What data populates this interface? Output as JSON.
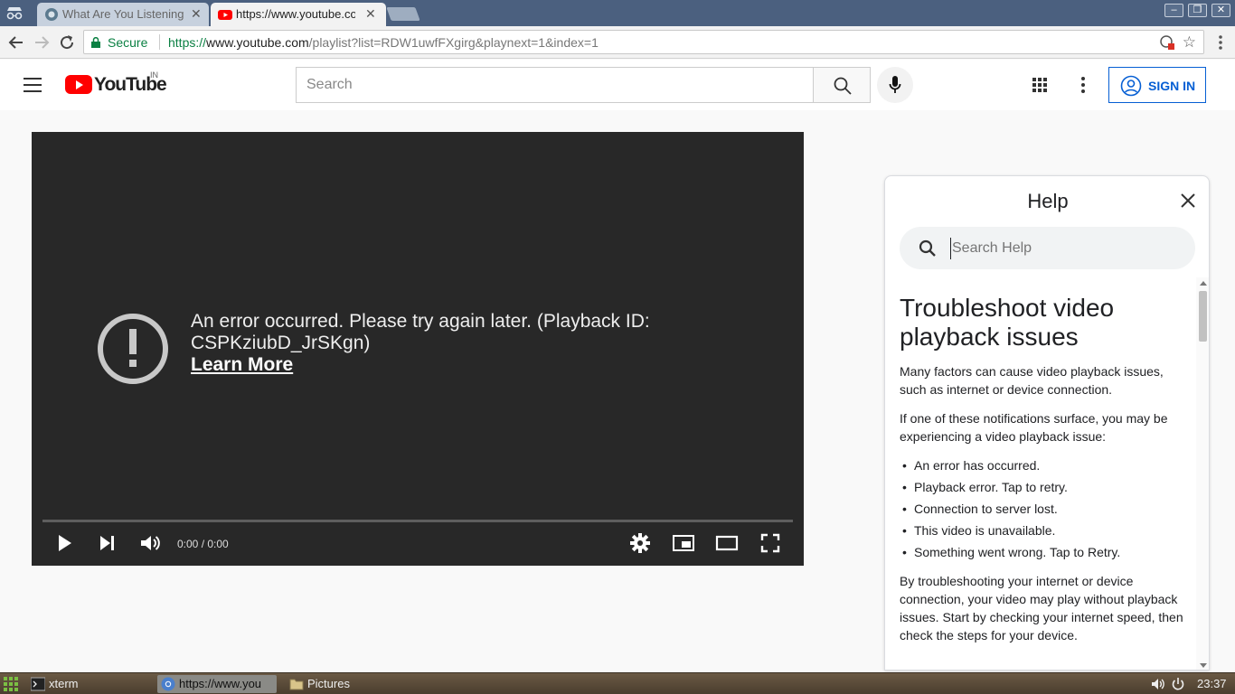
{
  "browser": {
    "tabs": [
      {
        "title": "What Are You Listening",
        "active": false
      },
      {
        "title": "https://www.youtube.com",
        "active": true
      }
    ],
    "window_controls": {
      "minimize": "–",
      "restore": "❐",
      "close": "✕"
    },
    "secure_label": "Secure",
    "url": {
      "scheme": "https://",
      "host": "www.youtube.com",
      "path": "/playlist?list=RDW1uwfFXgirg&playnext=1&index=1"
    }
  },
  "youtube": {
    "logo_text": "YouTube",
    "country_code": "IN",
    "search_placeholder": "Search",
    "sign_in_label": "SIGN IN",
    "brand_color": "#ff0000",
    "link_color": "#065fd4"
  },
  "player": {
    "error_message": "An error occurred. Please try again later. (Playback ID: CSPKziubD_JrSKgn)",
    "learn_more": "Learn More",
    "time": "0:00 / 0:00"
  },
  "help": {
    "title": "Help",
    "search_placeholder": "Search Help",
    "article_title": "Troubleshoot video playback issues",
    "intro": "Many factors can cause video playback issues, such as internet or device connection.",
    "lead": "If one of these notifications surface, you may be experiencing a video playback issue:",
    "notifications": [
      "An error has occurred.",
      "Playback error. Tap to retry.",
      "Connection to server lost.",
      "This video is unavailable.",
      "Something went wrong. Tap to Retry."
    ],
    "closing": "By troubleshooting your internet or device connection, your video may play without playback issues. Start by checking your internet speed, then check the steps for your device."
  },
  "taskbar": {
    "tasks": [
      "xterm",
      "https://www.you",
      "Pictures"
    ],
    "clock": "23:37"
  }
}
